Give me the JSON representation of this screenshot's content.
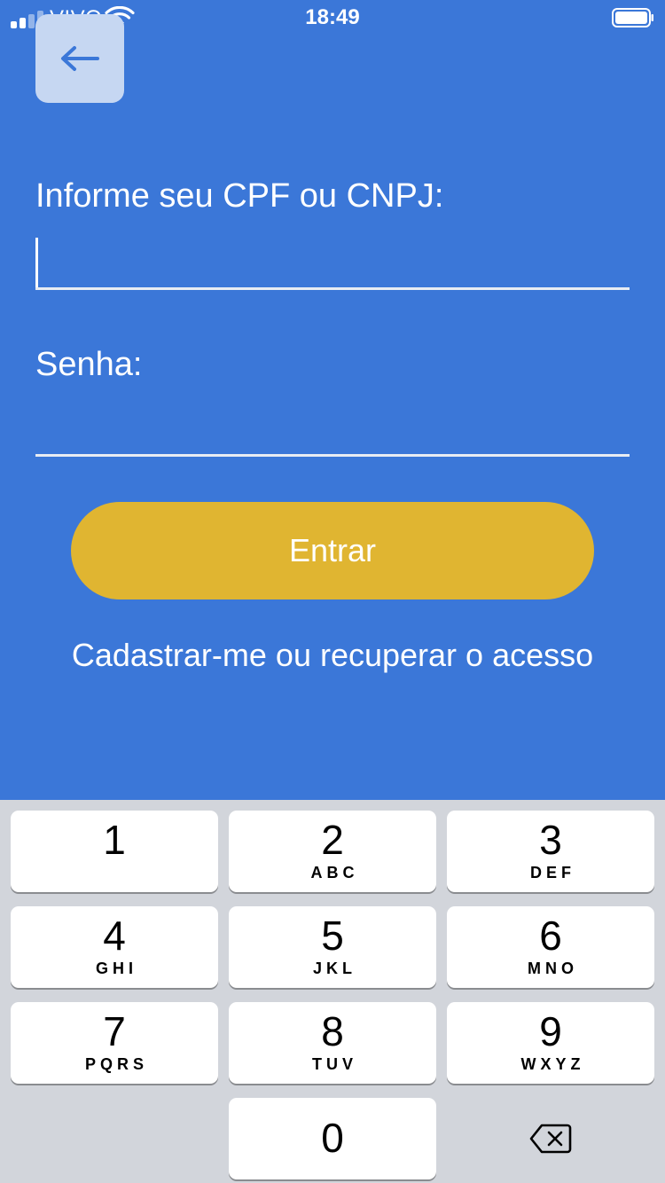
{
  "status_bar": {
    "carrier": "VIVO",
    "time": "18:49"
  },
  "form": {
    "document_label": "Informe seu CPF ou CNPJ:",
    "document_value": "",
    "password_label": "Senha:",
    "password_value": "",
    "submit_label": "Entrar",
    "register_link": "Cadastrar-me ou recuperar o acesso"
  },
  "keyboard": {
    "keys": [
      {
        "digit": "1",
        "letters": ""
      },
      {
        "digit": "2",
        "letters": "ABC"
      },
      {
        "digit": "3",
        "letters": "DEF"
      },
      {
        "digit": "4",
        "letters": "GHI"
      },
      {
        "digit": "5",
        "letters": "JKL"
      },
      {
        "digit": "6",
        "letters": "MNO"
      },
      {
        "digit": "7",
        "letters": "PQRS"
      },
      {
        "digit": "8",
        "letters": "TUV"
      },
      {
        "digit": "9",
        "letters": "WXYZ"
      },
      {
        "digit": "0",
        "letters": ""
      }
    ],
    "delete_icon": "backspace-icon"
  },
  "colors": {
    "background": "#3b77d8",
    "button": "#e0b531",
    "back_button": "#c6d7f2",
    "keyboard": "#d2d5db"
  }
}
